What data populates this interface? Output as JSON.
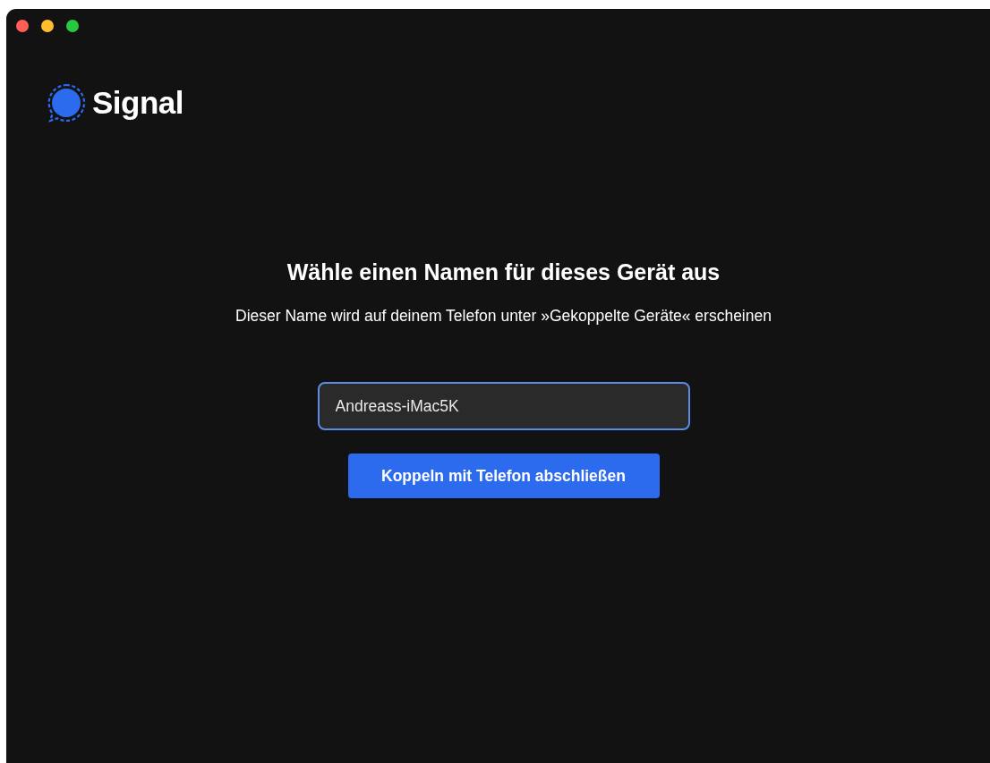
{
  "app": {
    "name": "Signal"
  },
  "heading": "Wähle einen Namen für dieses Gerät aus",
  "subtitle": "Dieser Name wird auf deinem Telefon unter »Gekoppelte Geräte« erscheinen",
  "name_field": {
    "value": "Andreass-iMac5K",
    "focused": true
  },
  "button": {
    "label": "Koppeln mit Telefon abschließen"
  }
}
